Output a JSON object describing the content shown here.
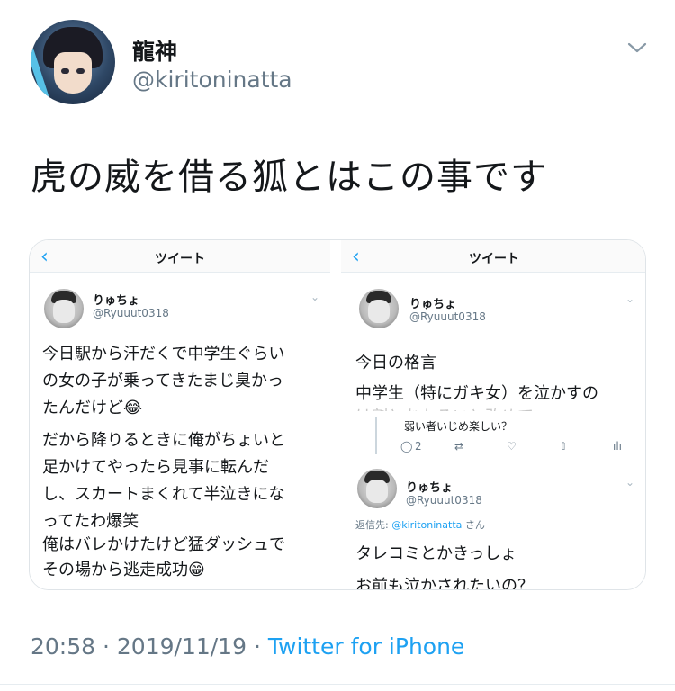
{
  "tweet": {
    "display_name": "龍神",
    "handle": "@kiritoninatta",
    "text": "虎の威を借る狐とはこの事です",
    "time": "20:58",
    "separator": "·",
    "date": "2019/11/19",
    "client": "Twitter for iPhone"
  },
  "media": {
    "left": {
      "nav_title": "ツイート",
      "user_name": "りゅちょ",
      "user_handle": "@Ryuuut0318",
      "lines": [
        "今日駅から汗だくで中学生ぐらい",
        "の女の子が乗ってきたまじ臭かっ",
        "たんだけど😂",
        "だから降りるときに俺がちょいと",
        "足かけてやったら見事に転んだ",
        "し、スカートまくれて半泣きにな",
        "ってたわ爆笑",
        "俺はバレかけたけど猛ダッシュで",
        "その場から逃走成功😁",
        "　　　　　　　　"
      ]
    },
    "right_top": {
      "nav_title": "ツイート",
      "user_name": "りゅちょ",
      "user_handle": "@Ryuuut0318",
      "line1": "今日の格言",
      "line2": "中学生（特にガキ女）を泣かすの",
      "line3_partial": "は割とおもろいと改めて..."
    },
    "right_bottom": {
      "quote_text": "弱い者いじめ楽しい？",
      "reply_count": "2",
      "user_name": "りゅちょ",
      "user_handle": "@Ryuuut0318",
      "reply_to_label": "返信先:",
      "reply_to_mention": "@kiritoninatta",
      "reply_to_suffix": "さん",
      "line1": "タレコミとかきっしょ",
      "line2": "お前も泣かされたいの？"
    }
  },
  "icons": {
    "back": "‹",
    "chevron": "⌄",
    "reply": "◯",
    "retweet": "⇄",
    "like": "♡",
    "share": "⇧",
    "analytics": "ılı"
  }
}
